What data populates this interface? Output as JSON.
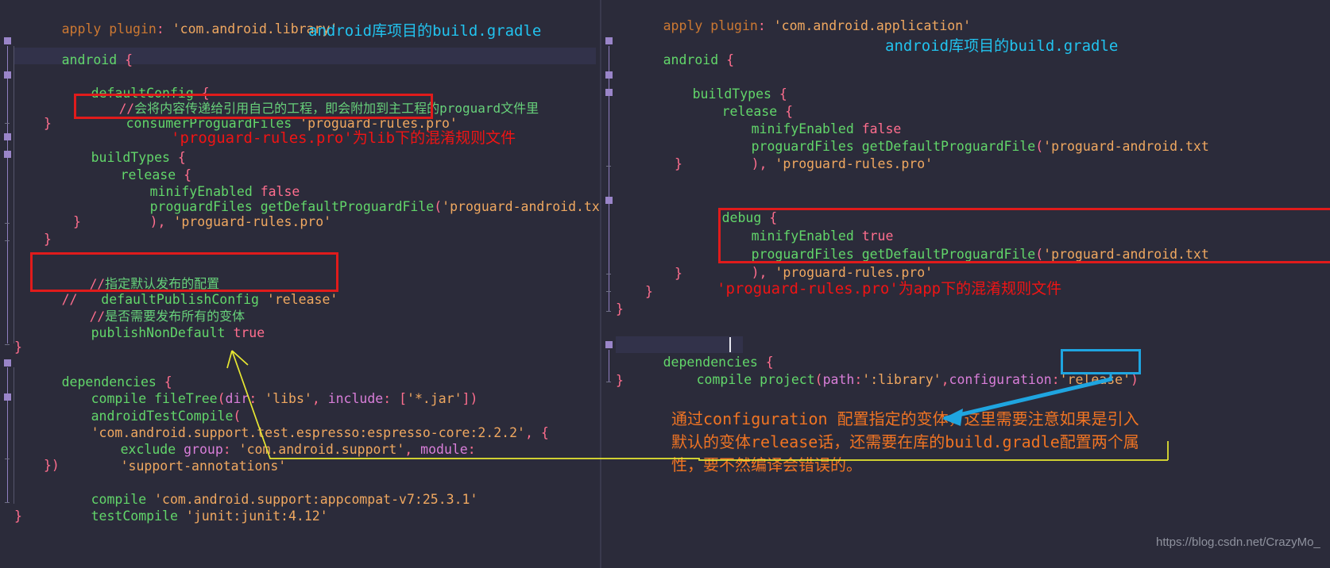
{
  "editor": {
    "theme_bg": "#2b2b3a",
    "left_pane": {
      "title_annotation": "android库项目的build.gradle",
      "lines": [
        "apply plugin: 'com.android.library'",
        "",
        "android {",
        "",
        "    defaultConfig {",
        "        //会将内容传递给引用自己的工程，即会附加到主工程的proguard文件里",
        "        consumerProguardFiles 'proguard-rules.pro'",
        "    }",
        "    buildTypes {",
        "        release {",
        "            minifyEnabled false",
        "            proguardFiles getDefaultProguardFile('proguard-android.txt'",
        "            ), 'proguard-rules.pro'",
        "        }",
        "    }",
        "",
        "    //指定默认发布的配置",
        "//    defaultPublishConfig 'release'",
        "    //是否需要发布所有的变体",
        "    publishNonDefault true",
        "",
        "}",
        "dependencies {",
        "    compile fileTree(dir: 'libs', include: ['*.jar'])",
        "    androidTestCompile(",
        "    'com.android.support.test.espresso:espresso-core:2.2.2', {",
        "        exclude group: 'com.android.support', module:",
        "        'support-annotations'",
        "    })",
        "    compile 'com.android.support:appcompat-v7:25.3.1'",
        "    testCompile 'junit:junit:4.12'",
        "}"
      ],
      "annotations": {
        "red_box_1_target": "consumerProguardFiles 'proguard-rules.pro'",
        "red_text_1": "'proguard-rules.pro'为lib下的混淆规则文件",
        "red_box_2_target": "defaultPublishConfig 'release'"
      }
    },
    "right_pane": {
      "title_annotation": "android库项目的build.gradle",
      "lines": [
        "apply plugin: 'com.android.application'",
        "",
        "android {",
        "",
        "    buildTypes {",
        "        release {",
        "            minifyEnabled false",
        "            proguardFiles getDefaultProguardFile('proguard-android.txt",
        "            ), 'proguard-rules.pro'",
        "        }",
        "",
        "        debug {",
        "            minifyEnabled true",
        "            proguardFiles getDefaultProguardFile('proguard-android.txt",
        "            ), 'proguard-rules.pro'",
        "        }",
        "    }",
        "}",
        "",
        "dependencies {",
        "    compile project(path:':library',configuration:'release')",
        "}"
      ],
      "annotations": {
        "red_text_1": "'proguard-rules.pro'为app下的混淆规则文件",
        "cyan_box_target": "'release'",
        "orange_note_line1": "通过configuration 配置指定的变体，这里需要注意如果是引入",
        "orange_note_line2": "默认的变体release话，还需要在库的build.gradle配置两个属",
        "orange_note_line3": "性，要不然编译会错误的。"
      }
    }
  },
  "watermark": "https://blog.csdn.net/CrazyMo_",
  "colors": {
    "red": "#f01414",
    "cyan": "#22c3ef",
    "orange": "#f07423",
    "yellow": "#e8e832",
    "keyword": "#cc7832",
    "string": "#f0a860",
    "function": "#62d66a",
    "comment": "#67d17a",
    "punct": "#ff6e8e"
  }
}
